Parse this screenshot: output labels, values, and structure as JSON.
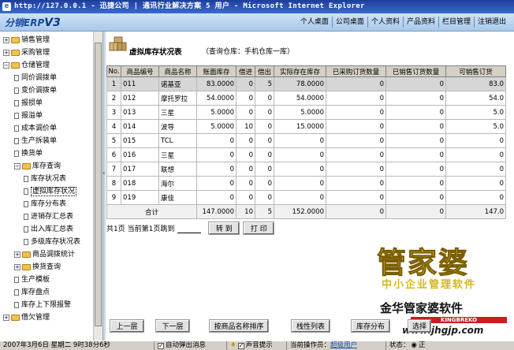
{
  "window": {
    "title": "http://127.0.0.1 - 迅捷公司 | 通讯行业解决方案 5 用户 - Microsoft Internet Explorer",
    "ie_glyph": "e"
  },
  "header": {
    "logo_text": "分销ERP",
    "logo_version": "V3",
    "nav": [
      "个人桌面",
      "公司桌面",
      "个人资料",
      "产品资料",
      "栏目管理",
      "注销退出"
    ]
  },
  "sidebar": {
    "items": [
      {
        "label": "销售管理",
        "type": "folder",
        "expanded": false
      },
      {
        "label": "采购管理",
        "type": "folder",
        "expanded": false
      },
      {
        "label": "仓储管理",
        "type": "folder",
        "expanded": true
      },
      {
        "label": "同价调拨单",
        "type": "doc"
      },
      {
        "label": "变价调拨单",
        "type": "doc"
      },
      {
        "label": "报损单",
        "type": "doc"
      },
      {
        "label": "报溢单",
        "type": "doc"
      },
      {
        "label": "成本调价单",
        "type": "doc"
      },
      {
        "label": "生产拆装单",
        "type": "doc"
      },
      {
        "label": "换货单",
        "type": "doc"
      },
      {
        "label": "库存查询",
        "type": "folder",
        "expanded": true
      },
      {
        "label": "库存状况表",
        "type": "doc"
      },
      {
        "label": "虚拟库存状况",
        "type": "doc",
        "selected": true
      },
      {
        "label": "库存分布表",
        "type": "doc"
      },
      {
        "label": "进销存汇总表",
        "type": "doc"
      },
      {
        "label": "出入库汇总表",
        "type": "doc"
      },
      {
        "label": "多级库存状况表",
        "type": "doc"
      },
      {
        "label": "商品调拨统计",
        "type": "folder",
        "expanded": false
      },
      {
        "label": "换货查询",
        "type": "folder",
        "expanded": false
      },
      {
        "label": "生产模板",
        "type": "doc"
      },
      {
        "label": "库存盘点",
        "type": "doc"
      },
      {
        "label": "库存上下限报警",
        "type": "doc"
      },
      {
        "label": "借欠管理",
        "type": "folder",
        "expanded": false
      }
    ]
  },
  "page": {
    "title": "虚拟库存状况表",
    "subtitle": "（查询仓库：手机仓库一库）"
  },
  "table": {
    "headers": [
      "No.",
      "商品编号",
      "商品名称",
      "账面库存",
      "借进",
      "借出",
      "实际存在库存",
      "已采购订货数量",
      "已销售订货数量",
      "可销售订货"
    ],
    "rows": [
      [
        "1",
        "011",
        "诺基亚",
        "83.0000",
        "0",
        "5",
        "78.0000",
        "0",
        "0",
        "83.0"
      ],
      [
        "2",
        "012",
        "摩托罗拉",
        "54.0000",
        "0",
        "0",
        "54.0000",
        "0",
        "0",
        "54.0"
      ],
      [
        "3",
        "013",
        "三星",
        "5.0000",
        "0",
        "0",
        "5.0000",
        "0",
        "0",
        "5.0"
      ],
      [
        "4",
        "014",
        "波导",
        "5.0000",
        "10",
        "0",
        "15.0000",
        "0",
        "0",
        "5.0"
      ],
      [
        "5",
        "015",
        "TCL",
        "0",
        "0",
        "0",
        "0",
        "0",
        "0",
        "0"
      ],
      [
        "6",
        "016",
        "三星",
        "0",
        "0",
        "0",
        "0",
        "0",
        "0",
        "0"
      ],
      [
        "7",
        "017",
        "联想",
        "0",
        "0",
        "0",
        "0",
        "0",
        "0",
        "0"
      ],
      [
        "8",
        "018",
        "海尔",
        "0",
        "0",
        "0",
        "0",
        "0",
        "0",
        "0"
      ],
      [
        "9",
        "019",
        "康佳",
        "0",
        "0",
        "0",
        "0",
        "0",
        "0",
        "0"
      ]
    ],
    "total": {
      "label": "合计",
      "values": [
        "147.0000",
        "10",
        "5",
        "152.0000",
        "0",
        "0",
        "147.0"
      ]
    }
  },
  "pager": {
    "text": "共1页 当前第1页跳到",
    "jump_label": "转 到",
    "print_label": "打 印",
    "page_value": ""
  },
  "buttons": {
    "prev": "上一层",
    "next": "下一层",
    "sort_by_name": "按商品名称排序",
    "tree_list": "栈性列表",
    "distribution": "库存分布",
    "select": "选择"
  },
  "watermark": {
    "line1": "管家婆",
    "line2": "中小企业管理软件",
    "line3": "金华管家婆软件",
    "line4": "KINGBREKO",
    "line5": "www.jhgjp.com"
  },
  "status": {
    "datetime": "2007年3月6日 星期二 9时38分6秒",
    "auto_popup_label": "自动弹出消息",
    "auto_popup_checked": true,
    "sound_label": "声音提示",
    "sound_checked": true,
    "operator_label": "当前操作员：",
    "operator": "超级用户",
    "state_label": "状态：",
    "state_value": "正"
  }
}
